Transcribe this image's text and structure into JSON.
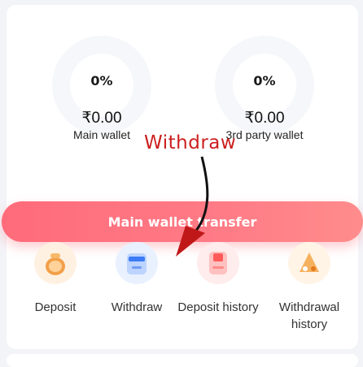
{
  "wallets": [
    {
      "percent": "0%",
      "amount": "₹0.00",
      "label": "Main wallet"
    },
    {
      "percent": "0%",
      "amount": "₹0.00",
      "label": "3rd party wallet"
    }
  ],
  "annotation": {
    "text": "Withdraw"
  },
  "transfer_button": {
    "label": "Main wallet transfer"
  },
  "actions": [
    {
      "label": "Deposit",
      "icon": "wallet-coin-icon"
    },
    {
      "label": "Withdraw",
      "icon": "card-icon"
    },
    {
      "label": "Deposit history",
      "icon": "deposit-history-icon"
    },
    {
      "label": "Withdrawal history",
      "icon": "withdrawal-history-icon"
    }
  ],
  "colors": {
    "accent": "#ff6b7a",
    "annotation_red": "#cc1f1f"
  }
}
